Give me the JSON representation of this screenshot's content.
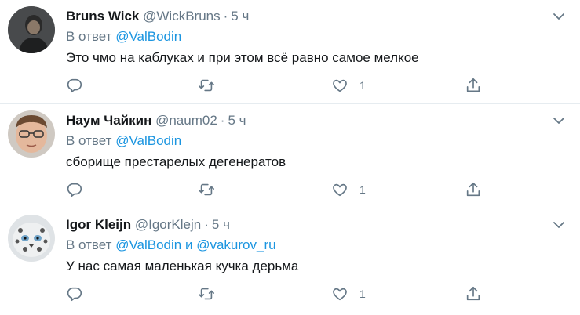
{
  "tweets": [
    {
      "name": "Bruns Wick",
      "handle": "@WickBruns",
      "dot": "·",
      "time": "5 ч",
      "reply_prefix": "В ответ",
      "mention1": "@ValBodin",
      "conj": "",
      "mention2": "",
      "text": "Это чмо на каблуках и при этом всё равно самое мелкое",
      "reply_count": "",
      "retweet_count": "",
      "like_count": "1"
    },
    {
      "name": "Наум Чайкин",
      "handle": "@naum02",
      "dot": "·",
      "time": "5 ч",
      "reply_prefix": "В ответ",
      "mention1": "@ValBodin",
      "conj": "",
      "mention2": "",
      "text": "сборище престарелых дегенератов",
      "reply_count": "",
      "retweet_count": "",
      "like_count": "1"
    },
    {
      "name": "Igor Kleijn",
      "handle": "@IgorKlejn",
      "dot": "·",
      "time": "5 ч",
      "reply_prefix": "В ответ",
      "mention1": "@ValBodin",
      "conj": "и",
      "mention2": "@vakurov_ru",
      "text": "У нас самая маленькая кучка дерьма",
      "reply_count": "",
      "retweet_count": "",
      "like_count": "1"
    }
  ],
  "colors": {
    "text": "#14171a",
    "secondary": "#657786",
    "link": "#1b95e0",
    "divider": "#e6ecf0"
  },
  "icons": [
    "reply-icon",
    "retweet-icon",
    "like-icon",
    "share-icon",
    "chevron-down-icon"
  ]
}
